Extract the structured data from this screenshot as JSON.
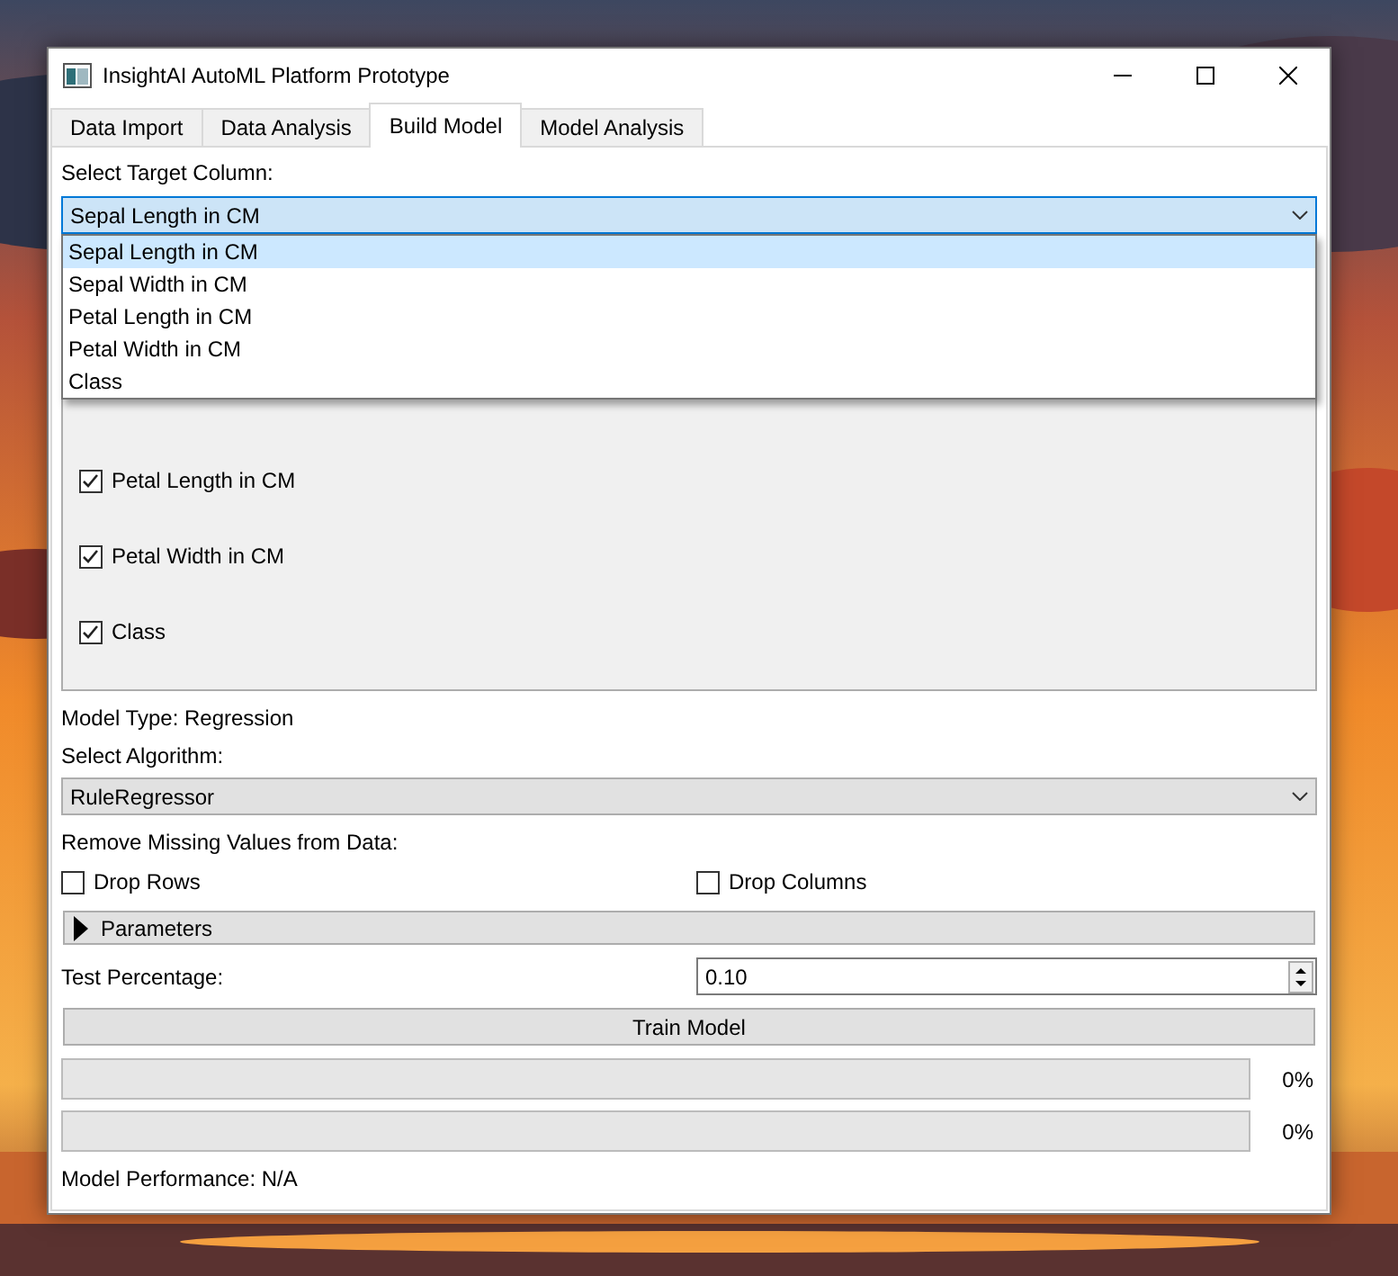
{
  "window": {
    "title": "InsightAI AutoML Platform Prototype"
  },
  "tabs": [
    {
      "label": "Data Import",
      "selected": false
    },
    {
      "label": "Data Analysis",
      "selected": false
    },
    {
      "label": "Build Model",
      "selected": true
    },
    {
      "label": "Model Analysis",
      "selected": false
    }
  ],
  "target": {
    "label": "Select Target Column:",
    "value": "Sepal Length in CM",
    "expanded": true,
    "options": [
      {
        "label": "Sepal Length in CM",
        "selected": true
      },
      {
        "label": "Sepal Width in CM",
        "selected": false
      },
      {
        "label": "Petal Length in CM",
        "selected": false
      },
      {
        "label": "Petal Width in CM",
        "selected": false
      },
      {
        "label": "Class",
        "selected": false
      }
    ]
  },
  "columns": [
    {
      "label": "Petal Length in CM",
      "checked": true
    },
    {
      "label": "Petal Width in CM",
      "checked": true
    },
    {
      "label": "Class",
      "checked": true
    }
  ],
  "model_type": "Model Type: Regression",
  "algorithm": {
    "label": "Select Algorithm:",
    "value": "RuleRegressor"
  },
  "missing": {
    "label": "Remove Missing Values from Data:",
    "options": [
      {
        "label": "Drop Rows",
        "checked": false
      },
      {
        "label": "Drop Columns",
        "checked": false
      }
    ]
  },
  "parameters": {
    "label": "Parameters",
    "expanded": false
  },
  "test": {
    "label": "Test Percentage:",
    "value": "0.10"
  },
  "train_button": "Train Model",
  "progress": [
    {
      "level": 0,
      "reading": "0%"
    },
    {
      "level": 0,
      "reading": "0%"
    }
  ],
  "performance": "Model Performance: N/A"
}
